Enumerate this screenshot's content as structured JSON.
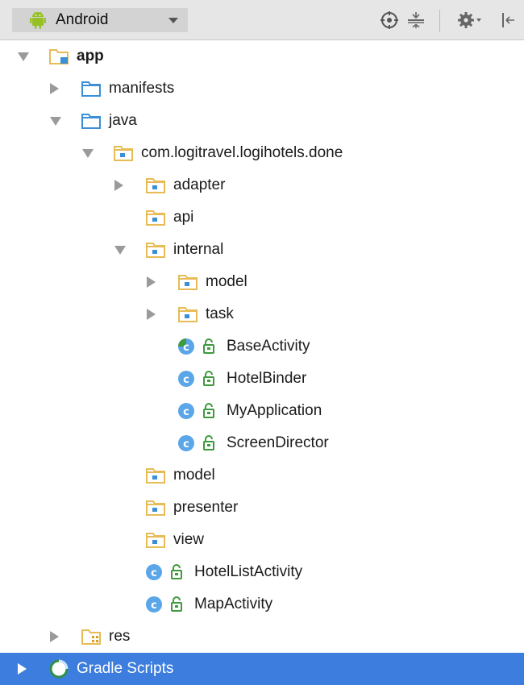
{
  "toolbar": {
    "view_selector": "Android",
    "icons": [
      "locate-icon",
      "collapse-all-icon",
      "settings-icon",
      "hide-panel-icon"
    ]
  },
  "tree": [
    {
      "label": "app",
      "depth": 0,
      "icon": "module-folder-icon",
      "arrow": "expanded",
      "bold": true
    },
    {
      "label": "manifests",
      "depth": 1,
      "icon": "folder-icon",
      "arrow": "collapsed"
    },
    {
      "label": "java",
      "depth": 1,
      "icon": "folder-icon",
      "arrow": "expanded"
    },
    {
      "label": "com.logitravel.logihotels.done",
      "depth": 2,
      "icon": "package-icon",
      "arrow": "expanded"
    },
    {
      "label": "adapter",
      "depth": 3,
      "icon": "package-icon",
      "arrow": "collapsed"
    },
    {
      "label": "api",
      "depth": 3,
      "icon": "package-icon",
      "arrow": "none"
    },
    {
      "label": "internal",
      "depth": 3,
      "icon": "package-icon",
      "arrow": "expanded"
    },
    {
      "label": "model",
      "depth": 4,
      "icon": "package-icon",
      "arrow": "collapsed"
    },
    {
      "label": "task",
      "depth": 4,
      "icon": "package-icon",
      "arrow": "collapsed"
    },
    {
      "label": "BaseActivity",
      "depth": 4,
      "icon": "abstract-class-icon",
      "arrow": "none",
      "access": "public"
    },
    {
      "label": "HotelBinder",
      "depth": 4,
      "icon": "class-icon",
      "arrow": "none",
      "access": "public"
    },
    {
      "label": "MyApplication",
      "depth": 4,
      "icon": "class-icon",
      "arrow": "none",
      "access": "public"
    },
    {
      "label": "ScreenDirector",
      "depth": 4,
      "icon": "class-icon",
      "arrow": "none",
      "access": "public"
    },
    {
      "label": "model",
      "depth": 3,
      "icon": "package-icon",
      "arrow": "none"
    },
    {
      "label": "presenter",
      "depth": 3,
      "icon": "package-icon",
      "arrow": "none"
    },
    {
      "label": "view",
      "depth": 3,
      "icon": "package-icon",
      "arrow": "none"
    },
    {
      "label": "HotelListActivity",
      "depth": 3,
      "icon": "class-icon",
      "arrow": "none",
      "access": "public"
    },
    {
      "label": "MapActivity",
      "depth": 3,
      "icon": "class-icon",
      "arrow": "none",
      "access": "public"
    },
    {
      "label": "res",
      "depth": 1,
      "icon": "resource-folder-icon",
      "arrow": "collapsed"
    },
    {
      "label": "Gradle Scripts",
      "depth": 0,
      "icon": "gradle-icon",
      "arrow": "collapsed",
      "selected": true
    }
  ],
  "colors": {
    "selection": "#3c7ddd",
    "folder_blue": "#3a8fd6",
    "package_yellow": "#e7bb56",
    "class_blue": "#5aa6e8",
    "access_green": "#3d9a3d",
    "android_green": "#97c024"
  }
}
